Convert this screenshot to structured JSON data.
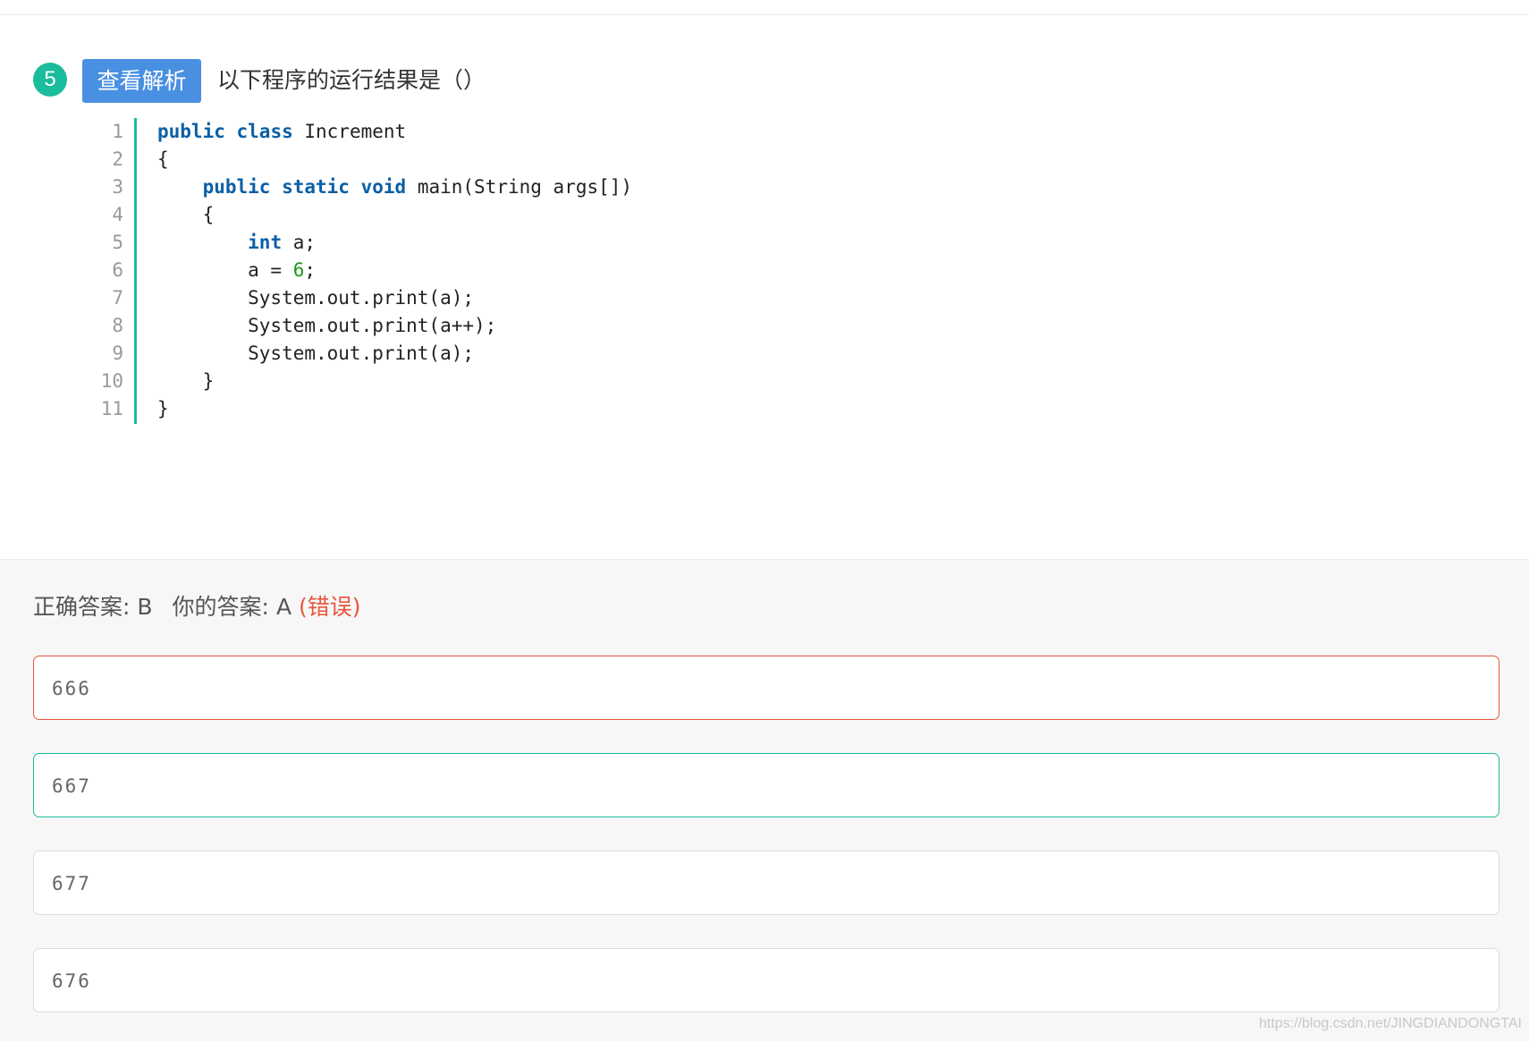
{
  "question": {
    "number": "5",
    "analysis_button": "查看解析",
    "text": "以下程序的运行结果是（）"
  },
  "code": {
    "line_numbers": [
      "1",
      "2",
      "3",
      "4",
      "5",
      "6",
      "7",
      "8",
      "9",
      "10",
      "11"
    ]
  },
  "answer": {
    "correct_label": "正确答案:",
    "correct_value": "B",
    "yours_label": "你的答案:",
    "yours_value": "A",
    "verdict": "(错误)"
  },
  "options": [
    {
      "text": "666",
      "state": "selected-wrong"
    },
    {
      "text": "667",
      "state": "correct"
    },
    {
      "text": "677",
      "state": "normal"
    },
    {
      "text": "676",
      "state": "normal"
    }
  ],
  "watermark": "https://blog.csdn.net/JINGDIANDONGTAI",
  "colors": {
    "accent_green": "#1abc9c",
    "button_blue": "#4a90e2",
    "error_red": "#e8553e",
    "keyword_blue": "#0b5fa5",
    "number_green": "#1a9a1a"
  }
}
